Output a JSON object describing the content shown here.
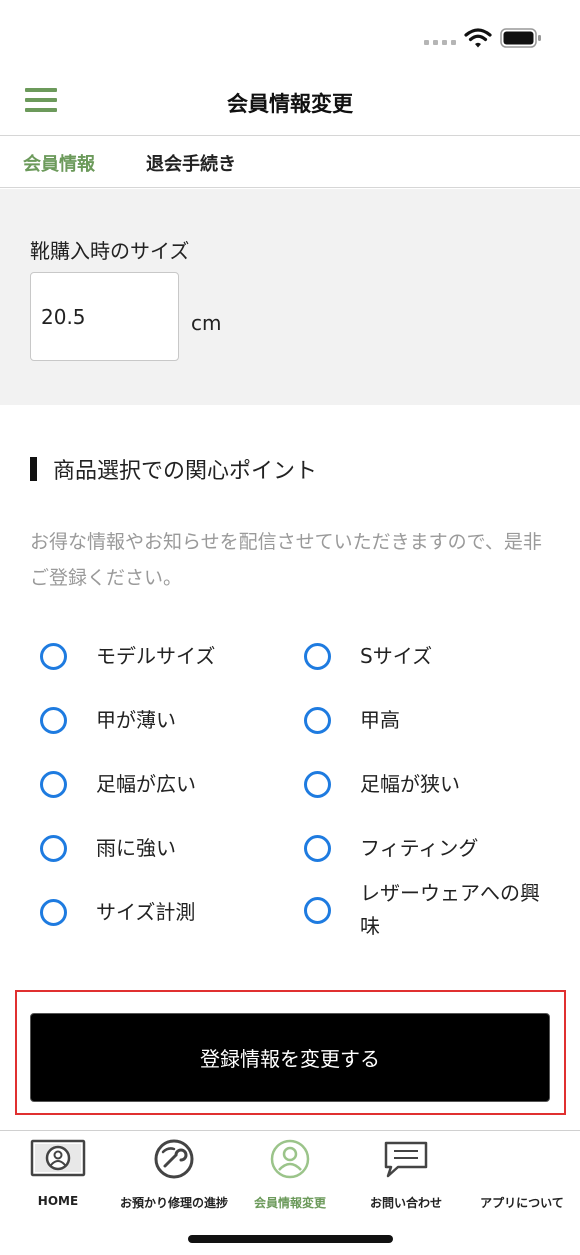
{
  "status_bar": {
    "icons": [
      "signal-icon",
      "wifi-icon",
      "battery-icon"
    ]
  },
  "header": {
    "title": "会員情報変更",
    "menu_icon": "hamburger-menu-icon"
  },
  "tabs": [
    {
      "label": "会員情報",
      "active": true
    },
    {
      "label": "退会手続き",
      "active": false
    }
  ],
  "shoe_size": {
    "label": "靴購入時のサイズ",
    "value": "20.5",
    "unit": "cm"
  },
  "interests": {
    "heading": "商品選択での関心ポイント",
    "notice": "お得な情報やお知らせを配信させていただきますので、是非ご登録ください。",
    "options": [
      {
        "label": "モデルサイズ",
        "checked": false
      },
      {
        "label": "Sサイズ",
        "checked": false
      },
      {
        "label": "甲が薄い",
        "checked": false
      },
      {
        "label": "甲高",
        "checked": false
      },
      {
        "label": "足幅が広い",
        "checked": false
      },
      {
        "label": "足幅が狭い",
        "checked": false
      },
      {
        "label": "雨に強い",
        "checked": false
      },
      {
        "label": "フィティング",
        "checked": false
      },
      {
        "label": "サイズ計測",
        "checked": false
      },
      {
        "label": "レザーウェアへの興味",
        "checked": false
      }
    ]
  },
  "submit": {
    "label": "登録情報を変更する"
  },
  "bottom_nav": [
    {
      "label": "HOME",
      "icon": "home-icon",
      "active": false
    },
    {
      "label": "お預かり修理の進捗",
      "icon": "repair-progress-icon",
      "active": false
    },
    {
      "label": "会員情報変更",
      "icon": "member-info-icon",
      "active": true
    },
    {
      "label": "お問い合わせ",
      "icon": "chat-bubble-icon",
      "active": false
    },
    {
      "label": "アプリについて",
      "icon": "app-info-icon",
      "active": false
    }
  ],
  "colors": {
    "accent_green": "#6c9a5b",
    "radio_blue": "#1e7be0",
    "highlight_red": "#e03030"
  }
}
